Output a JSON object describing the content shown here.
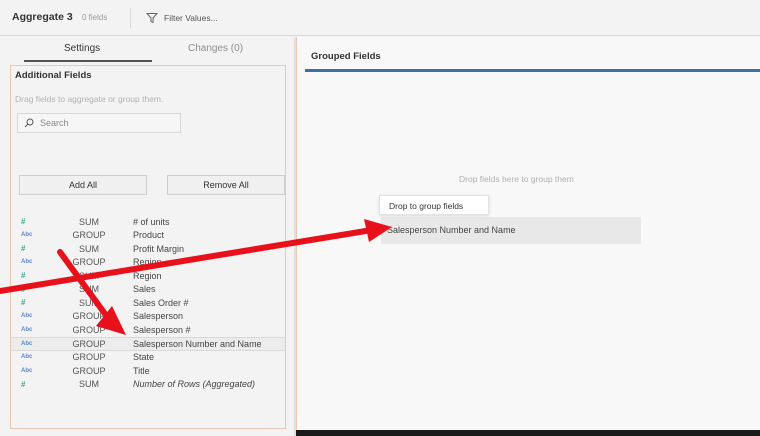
{
  "toolbar": {
    "title": "Aggregate 3",
    "field_count": "0 fields",
    "filter_label": "Filter Values..."
  },
  "tabs": [
    {
      "label": "Settings",
      "active": true
    },
    {
      "label": "Changes (0)",
      "active": false
    }
  ],
  "additional_fields": {
    "title": "Additional Fields",
    "hint": "Drag fields to aggregate or group them.",
    "search_placeholder": "Search",
    "add_all_label": "Add All",
    "remove_all_label": "Remove All",
    "fields": [
      {
        "type": "number",
        "type_glyph": "#",
        "agg": "SUM",
        "name": "# of units"
      },
      {
        "type": "string",
        "type_glyph": "Abc",
        "agg": "GROUP",
        "name": "Product"
      },
      {
        "type": "number",
        "type_glyph": "#",
        "agg": "SUM",
        "name": "Profit Margin"
      },
      {
        "type": "string",
        "type_glyph": "Abc",
        "agg": "GROUP",
        "name": "Region"
      },
      {
        "type": "number",
        "type_glyph": "#",
        "agg": "SUM",
        "name": "Region"
      },
      {
        "type": "number",
        "type_glyph": "#",
        "agg": "SUM",
        "name": "Sales"
      },
      {
        "type": "number",
        "type_glyph": "#",
        "agg": "SUM",
        "name": "Sales Order #"
      },
      {
        "type": "string",
        "type_glyph": "Abc",
        "agg": "GROUP",
        "name": "Salesperson"
      },
      {
        "type": "string",
        "type_glyph": "Abc",
        "agg": "GROUP",
        "name": "Salesperson #"
      },
      {
        "type": "string",
        "type_glyph": "Abc",
        "agg": "GROUP",
        "name": "Salesperson Number and Name",
        "selected": true
      },
      {
        "type": "string",
        "type_glyph": "Abc",
        "agg": "GROUP",
        "name": "State"
      },
      {
        "type": "string",
        "type_glyph": "Abc",
        "agg": "GROUP",
        "name": "Title"
      },
      {
        "type": "number",
        "type_glyph": "#",
        "agg": "SUM",
        "name": "Number of Rows (Aggregated)",
        "italic": true
      }
    ]
  },
  "grouped_fields": {
    "title": "Grouped Fields",
    "drop_hint": "Drop fields here to group them",
    "tooltip": "Drop to group fields",
    "dragged_item": "Salesperson Number and Name"
  },
  "colors": {
    "accent_bar": "#3d6fa3",
    "number_icon": "#45a88f",
    "string_icon": "#5b87c7",
    "annotation_arrow": "#e8101a",
    "panel_border": "#e9c9b3"
  }
}
